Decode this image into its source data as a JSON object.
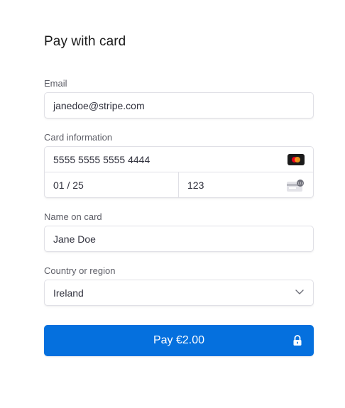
{
  "form": {
    "title": "Pay with card",
    "email": {
      "label": "Email",
      "value": "janedoe@stripe.com"
    },
    "card": {
      "label": "Card information",
      "number": "5555 5555 5555 4444",
      "expiry": "01 / 25",
      "cvc": "123",
      "brand_icon": "mastercard-icon",
      "cvc_icon": "cvc-card-icon"
    },
    "name": {
      "label": "Name on card",
      "value": "Jane Doe"
    },
    "country": {
      "label": "Country or region",
      "selected": "Ireland",
      "icon": "chevron-down-icon"
    },
    "pay_button": {
      "label": "Pay €2.00",
      "icon": "lock-icon"
    }
  },
  "colors": {
    "accent": "#0570de",
    "border": "#e0e0e6",
    "label": "#5c5d66",
    "text": "#30313d"
  }
}
